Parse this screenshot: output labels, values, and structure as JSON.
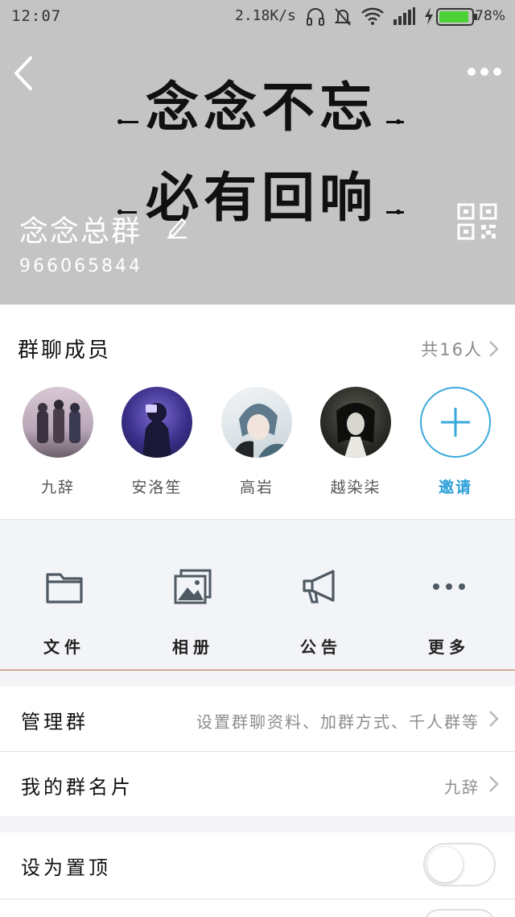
{
  "status_bar": {
    "time": "12:07",
    "net_speed": "2.18K/s",
    "battery_percent": "78%"
  },
  "header": {
    "banner_line1": "念念不忘",
    "banner_line2": "必有回响",
    "group_name": "念念总群",
    "group_id": "966065844"
  },
  "members": {
    "title": "群聊成员",
    "total": "共16人",
    "list": [
      {
        "name": "九辞"
      },
      {
        "name": "安洛笙"
      },
      {
        "name": "高岩"
      },
      {
        "name": "越染柒"
      }
    ],
    "invite_label": "邀请"
  },
  "actions": [
    {
      "label": "文件",
      "icon": "folder-icon"
    },
    {
      "label": "相册",
      "icon": "album-icon"
    },
    {
      "label": "公告",
      "icon": "megaphone-icon"
    },
    {
      "label": "更多",
      "icon": "more-dots-icon"
    }
  ],
  "rows": {
    "manage": {
      "label": "管理群",
      "value": "设置群聊资料、加群方式、千人群等"
    },
    "my_card": {
      "label": "我的群名片",
      "value": "九辞"
    },
    "pin": {
      "label": "设为置顶",
      "on": false
    }
  },
  "colors": {
    "header_bg": "#c4c4c4",
    "accent": "#2a9fd8",
    "battery_green": "#4cd137"
  }
}
